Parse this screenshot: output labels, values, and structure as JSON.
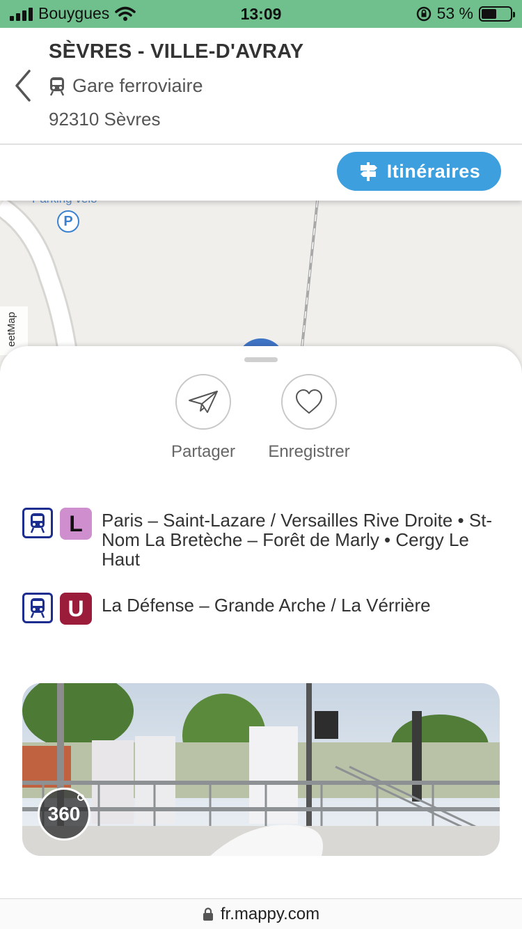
{
  "status_bar": {
    "carrier": "Bouygues",
    "time": "13:09",
    "battery_percent": "53 %",
    "battery_level": 0.53
  },
  "header": {
    "title": "SÈVRES - VILLE-D'AVRAY",
    "type_icon": "train-icon",
    "type": "Gare ferroviaire",
    "address": "92310 Sèvres"
  },
  "route_button": {
    "icon": "signpost-icon",
    "label": "Itinéraires",
    "color": "#3d9fde"
  },
  "map": {
    "label": "Parking vélo",
    "parking_glyph": "P",
    "attribution": "eetMap"
  },
  "actions": [
    {
      "icon": "paper-plane-icon",
      "label": "Partager"
    },
    {
      "icon": "heart-icon",
      "label": "Enregistrer"
    }
  ],
  "lines": [
    {
      "mode_icon": "train-icon",
      "line": "L",
      "line_color": "#cf8fcf",
      "text_color": "#111111",
      "destinations": "Paris – Saint-Lazare / Versailles Rive Droite • St-Nom La Bretèche – Forêt de Marly • Cergy Le Haut"
    },
    {
      "mode_icon": "train-icon",
      "line": "U",
      "line_color": "#9b1b3b",
      "text_color": "#ffffff",
      "destinations": "La Défense – Grande Arche / La Vérrière"
    }
  ],
  "photo": {
    "badge": "360"
  },
  "url_bar": {
    "icon": "lock-icon",
    "url": "fr.mappy.com"
  }
}
